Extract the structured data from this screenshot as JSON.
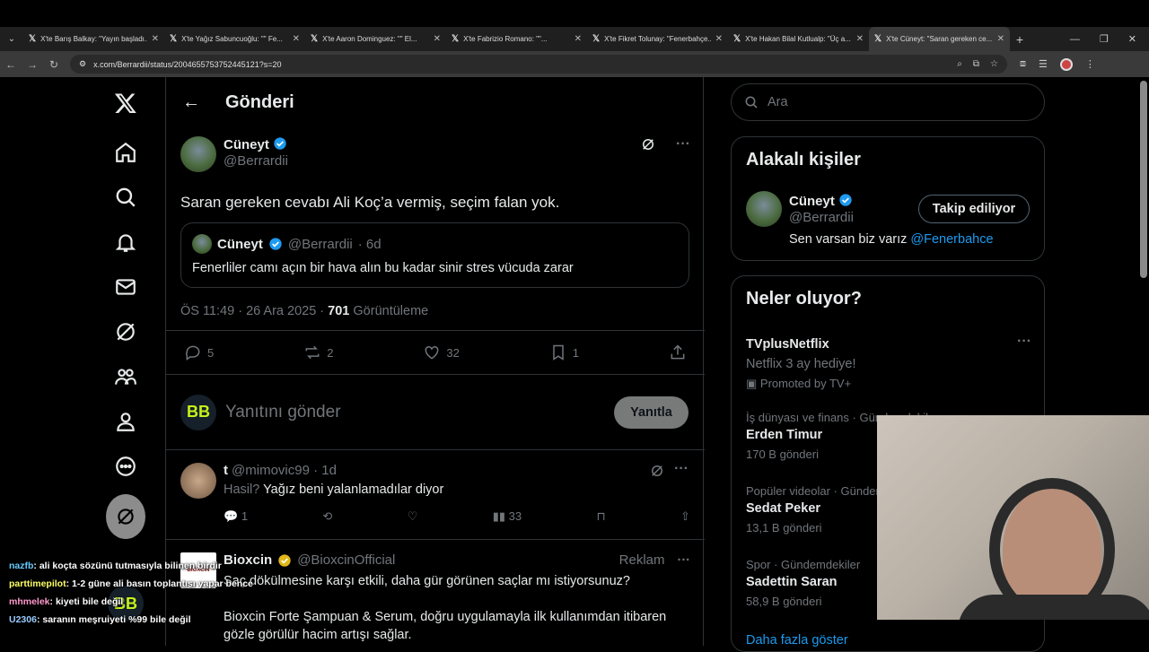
{
  "browser": {
    "tabs": [
      {
        "label": "X'te Barış Balkay: \"Yayın başladı..."
      },
      {
        "label": "X'te Yağız Sabuncuoğlu: \"\" Fe..."
      },
      {
        "label": "X'te Aaron Dominguez: \"\" El..."
      },
      {
        "label": "X'te Fabrizio Romano: \"\"..."
      },
      {
        "label": "X'te Fikret Tolunay: \"Fenerbahçe..."
      },
      {
        "label": "X'te Hakan Bilal Kutlualp: \"Üç a..."
      },
      {
        "label": "X'te Cüneyt: \"Saran gereken ce..."
      }
    ],
    "url": "x.com/Berrardii/status/2004655753752445121?s=20"
  },
  "header": {
    "title": "Gönderi"
  },
  "post": {
    "name": "Cüneyt",
    "handle": "@Berrardii",
    "text": "Saran gereken cevabı Ali Koç’a vermiş, seçim falan yok.",
    "quote": {
      "name": "Cüneyt",
      "handle": "@Berrardii",
      "age": "· 6d",
      "text": "Fenerliler camı açın bir hava alın bu kadar sinir stres vücuda zarar"
    },
    "time": "ÖS 11:49 · 26 Ara 2025 ·",
    "views": "701",
    "views_label": "Görüntüleme",
    "counts": {
      "replies": "5",
      "reposts": "2",
      "likes": "32",
      "bookmarks": "1"
    }
  },
  "reply_box": {
    "placeholder": "Yanıtını gönder",
    "button": "Yanıtla",
    "logo": "BB"
  },
  "reply1": {
    "name": "t",
    "handle": "@mimovic99 · 1d",
    "text": "Yağız beni yalanlamadılar diyor",
    "text_prefix": "Hasil?",
    "replies": "1",
    "views": "33"
  },
  "ad": {
    "name": "Bioxcin",
    "handle": "@BioxcinOfficial",
    "label": "Reklam",
    "line1": "Saç dökülmesine karşı etkili, daha gür görünen saçlar mı istiyorsunuz?",
    "line2": "Bioxcin Forte Şampuan & Serum, doğru uygulamayla ilk kullanımdan itibaren gözle görülür hacim artışı sağlar.",
    "logo_text": "BIOXCIN"
  },
  "sidebar": {
    "search_placeholder": "Ara",
    "related_title": "Alakalı kişiler",
    "related": {
      "name": "Cüneyt",
      "handle": "@Berrardii",
      "bio": "Sen varsan biz varız",
      "bio_link": "@Fenerbahce",
      "button": "Takip ediliyor"
    },
    "trends_title": "Neler oluyor?",
    "trends": [
      {
        "title": "TVplusNetflix",
        "sub": "Netflix 3 ay hediye!",
        "promo": "Promoted by TV+"
      },
      {
        "cat": "İş dünyası ve finans · Gündemdekiler",
        "title": "Erden Timur",
        "count": "170 B gönderi"
      },
      {
        "cat": "Popüler videolar · Gündemdekiler",
        "title": "Sedat Peker",
        "count": "13,1 B gönderi"
      },
      {
        "cat": "Spor · Gündemdekiler",
        "title": "Sadettin Saran",
        "count": "58,9 B gönderi"
      }
    ],
    "more": "Daha fazla göster"
  },
  "chat": [
    {
      "user": "nazfb",
      "msg": ": ali koçta sözünü tutmasıyla bilinen birdir"
    },
    {
      "user": "parttimepilot",
      "msg": ": 1-2 güne ali basın toplantısı yapar bence"
    },
    {
      "user": "mhmelek",
      "msg": ": kiyeti bile değil"
    },
    {
      "user": "U2306",
      "msg": ": saranın meşruiyeti %99 bile değil"
    }
  ]
}
